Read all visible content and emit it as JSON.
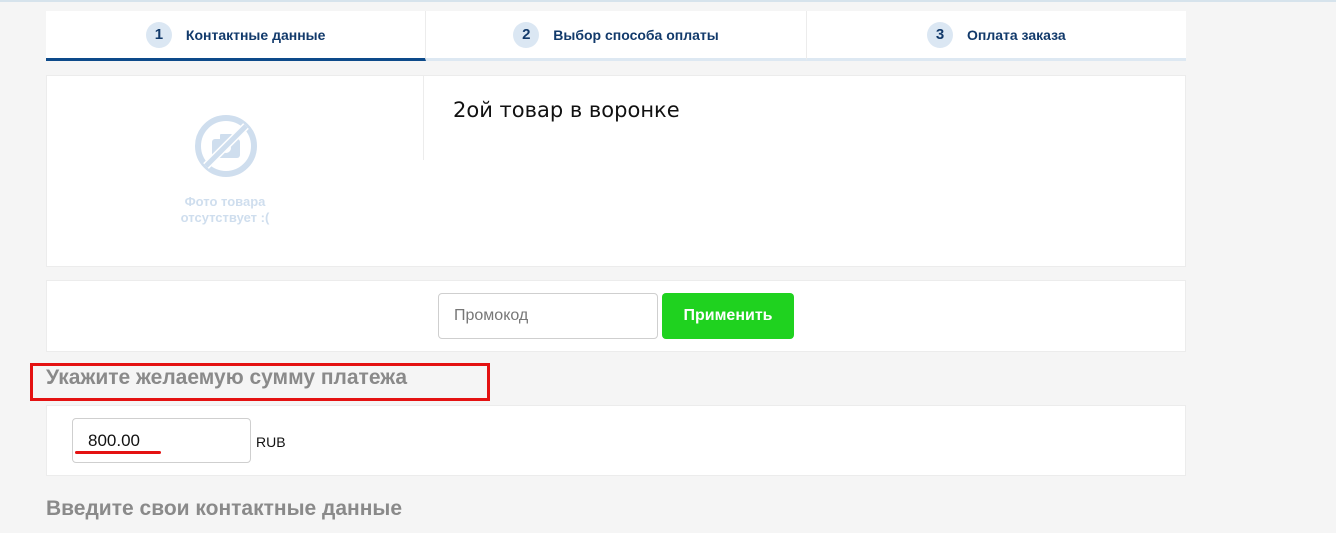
{
  "steps": [
    {
      "number": "1",
      "label": "Контактные данные",
      "active": true
    },
    {
      "number": "2",
      "label": "Выбор способа оплаты",
      "active": false
    },
    {
      "number": "3",
      "label": "Оплата заказа",
      "active": false
    }
  ],
  "product": {
    "title": "2ой товар в воронке",
    "no_photo_text": "Фото товара отсутствует :(",
    "no_photo_icon": "no-photo-icon"
  },
  "promo": {
    "placeholder": "Промокод",
    "value": "",
    "apply_label": "Применить",
    "apply_color": "#1fd21f"
  },
  "payment": {
    "heading": "Укажите желаемую сумму платежа",
    "amount": "800.00",
    "currency": "RUB",
    "highlight_color": "#e41212"
  },
  "contacts": {
    "heading": "Введите свои контактные данные"
  },
  "colors": {
    "step_text": "#123a6b",
    "step_active_border": "#0d4a8a",
    "heading_gray": "#8a8a8a"
  }
}
